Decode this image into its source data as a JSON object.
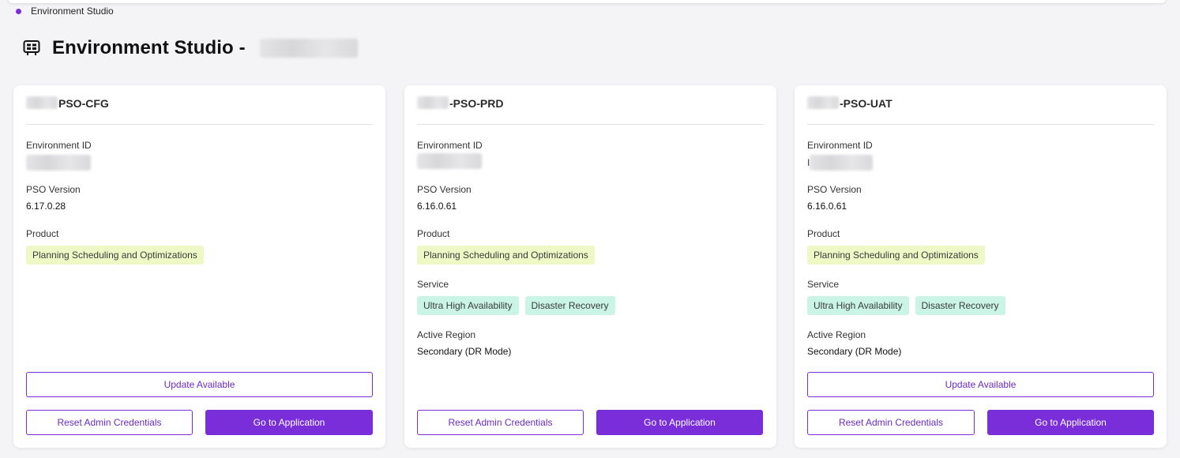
{
  "breadcrumb": {
    "label": "Environment Studio"
  },
  "header": {
    "title": "Environment Studio -"
  },
  "labels": {
    "environment_id": "Environment ID",
    "pso_version": "PSO Version",
    "product": "Product",
    "service": "Service",
    "active_region": "Active Region"
  },
  "buttons": {
    "update": "Update Available",
    "reset": "Reset Admin Credentials",
    "go": "Go to Application"
  },
  "colors": {
    "accent": "#7a2ed9",
    "product_tag_bg": "#eef7c6",
    "service_tag_bg": "#c9f4e6"
  },
  "cards": [
    {
      "name_suffix": "PSO-CFG",
      "environment_id_visible": "",
      "pso_version": "6.17.0.28",
      "product": "Planning Scheduling and Optimizations",
      "services": [],
      "active_region": ""
    },
    {
      "name_suffix": "-PSO-PRD",
      "environment_id_visible": "",
      "pso_version": "6.16.0.61",
      "product": "Planning Scheduling and Optimizations",
      "services": [
        "Ultra High Availability",
        "Disaster Recovery"
      ],
      "active_region": "Secondary (DR Mode)"
    },
    {
      "name_suffix": "-PSO-UAT",
      "environment_id_visible": "I",
      "pso_version": "6.16.0.61",
      "product": "Planning Scheduling and Optimizations",
      "services": [
        "Ultra High Availability",
        "Disaster Recovery"
      ],
      "active_region": "Secondary (DR Mode)"
    }
  ]
}
